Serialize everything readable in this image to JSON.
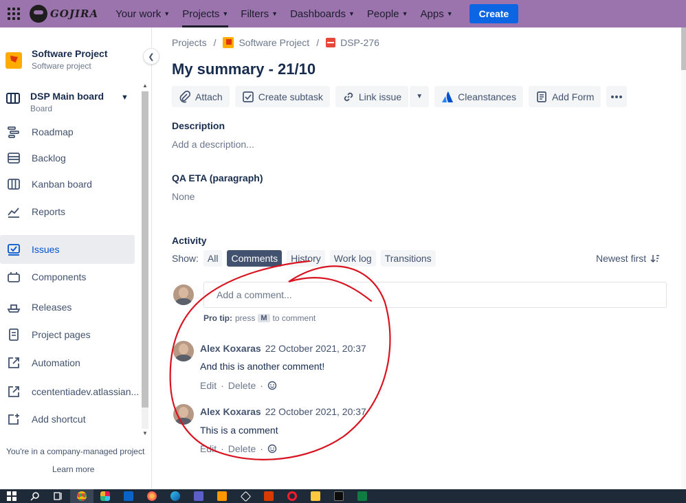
{
  "topnav": {
    "logo_text": "GOJIRA",
    "items": [
      {
        "label": "Your work"
      },
      {
        "label": "Projects"
      },
      {
        "label": "Filters"
      },
      {
        "label": "Dashboards"
      },
      {
        "label": "People"
      },
      {
        "label": "Apps"
      }
    ],
    "create_label": "Create"
  },
  "sidebar": {
    "project_name": "Software Project",
    "project_type": "Software project",
    "board_name": "DSP Main board",
    "board_sub": "Board",
    "items": [
      {
        "label": "Roadmap",
        "icon": "roadmap-icon"
      },
      {
        "label": "Backlog",
        "icon": "backlog-icon"
      },
      {
        "label": "Kanban board",
        "icon": "kanban-icon"
      },
      {
        "label": "Reports",
        "icon": "reports-icon"
      },
      {
        "label": "Issues",
        "icon": "issues-icon",
        "selected": true
      },
      {
        "label": "Components",
        "icon": "components-icon"
      },
      {
        "label": "Releases",
        "icon": "releases-icon"
      },
      {
        "label": "Project pages",
        "icon": "pages-icon"
      },
      {
        "label": "Automation",
        "icon": "automation-icon"
      },
      {
        "label": "ccententiadev.atlassian...",
        "icon": "external-link-icon"
      },
      {
        "label": "Add shortcut",
        "icon": "add-shortcut-icon"
      }
    ],
    "footer_text": "You're in a company-managed project",
    "learn_more": "Learn more"
  },
  "breadcrumbs": {
    "projects": "Projects",
    "project": "Software Project",
    "issue": "DSP-276"
  },
  "issue": {
    "title": "My summary - 21/10",
    "toolbar": {
      "attach": "Attach",
      "create_subtask": "Create subtask",
      "link_issue": "Link issue",
      "cleanstances": "Cleanstances",
      "add_form": "Add Form"
    },
    "description_label": "Description",
    "description_placeholder": "Add a description...",
    "qa_label": "QA ETA (paragraph)",
    "qa_value": "None"
  },
  "activity": {
    "label": "Activity",
    "show_label": "Show:",
    "filters": [
      "All",
      "Comments",
      "History",
      "Work log",
      "Transitions"
    ],
    "active_filter": "Comments",
    "sort_label": "Newest first",
    "comment_placeholder": "Add a comment...",
    "protip_bold": "Pro tip:",
    "protip_press": "press",
    "protip_key": "M",
    "protip_rest": "to comment",
    "comments": [
      {
        "author": "Alex Koxaras",
        "date": "22 October 2021, 20:37",
        "body": "And this is another comment!",
        "edit": "Edit",
        "delete": "Delete"
      },
      {
        "author": "Alex Koxaras",
        "date": "22 October 2021, 20:37",
        "body": "This is a comment",
        "edit": "Edit",
        "delete": "Delete"
      }
    ]
  },
  "colors": {
    "nav_bg": "#9b74ad",
    "create_bg": "#0c66e4",
    "annotation_red": "#d9121f",
    "active_filter_bg": "#42526e"
  },
  "taskbar": {
    "icons": [
      "windows-start-icon",
      "search-icon",
      "task-view-icon",
      "chrome-icon",
      "slack-icon",
      "outlook-icon",
      "firefox-icon",
      "edge-icon",
      "teams-icon",
      "sublime-icon",
      "unity-icon",
      "office-icon",
      "opera-icon",
      "file-explorer-icon",
      "terminal-icon",
      "excel-icon"
    ]
  }
}
